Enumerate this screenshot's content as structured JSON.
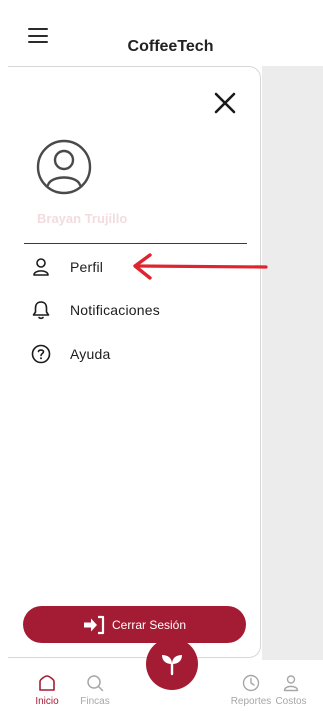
{
  "app": {
    "title": "CoffeeTech"
  },
  "drawer": {
    "user_name": "Brayan Trujillo",
    "items": [
      {
        "label": "Perfil",
        "icon": "person-icon"
      },
      {
        "label": "Notificaciones",
        "icon": "bell-icon"
      },
      {
        "label": "Ayuda",
        "icon": "help-icon"
      }
    ],
    "logout_label": "Cerrar Sesión"
  },
  "bottom_nav": {
    "items": [
      {
        "label": "Inicio",
        "icon": "home-icon",
        "active": true
      },
      {
        "label": "Fincas",
        "icon": "search-icon"
      },
      {
        "label": "Reportes",
        "icon": "clock-icon"
      },
      {
        "label": "Costos",
        "icon": "person-icon"
      }
    ],
    "fab_icon": "sprout-icon"
  },
  "colors": {
    "primary": "#a31c33",
    "annotation_arrow": "#e0242f",
    "user_name": "#f2dcdf"
  }
}
